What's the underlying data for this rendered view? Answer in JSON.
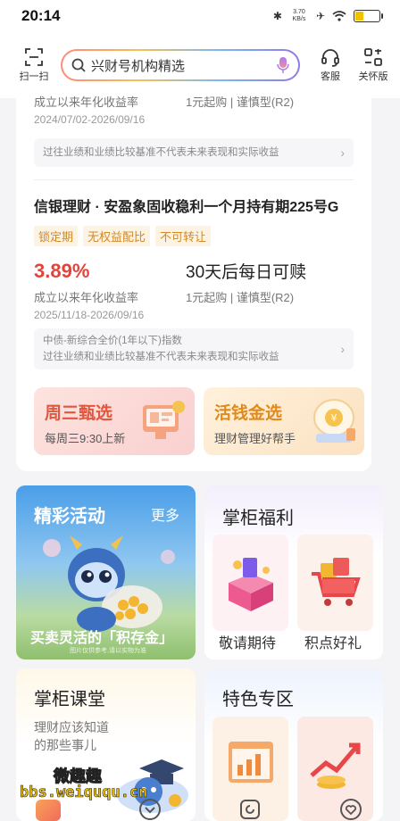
{
  "status": {
    "time": "20:14",
    "net_speed": "3.70 KB/s"
  },
  "header": {
    "scan_label": "扫一扫",
    "search_placeholder": "兴财号机构精选",
    "service_label": "客服",
    "care_label": "关怀版"
  },
  "product_prev": {
    "rate_label": "成立以来年化收益率",
    "purchase_info": "1元起购 | 谨慎型(R2)",
    "date_range": "2024/07/02-2026/09/16",
    "notice": "过往业绩和业绩比较基准不代表未来表现和实际收益"
  },
  "product": {
    "title": "信银理财 · 安盈象固收稳利一个月持有期225号G",
    "tags": [
      "锁定期",
      "无权益配比",
      "不可转让"
    ],
    "rate": "3.89%",
    "redeem": "30天后每日可赎",
    "rate_label": "成立以来年化收益率",
    "purchase_info": "1元起购 | 谨慎型(R2)",
    "date_range": "2025/11/18-2026/09/16",
    "benchmark": "中债-新综合全价(1年以下)指数",
    "notice": "过往业绩和业绩比较基准不代表未来表现和实际收益"
  },
  "promos": [
    {
      "title": "周三甄选",
      "subtitle": "每周三9:30上新"
    },
    {
      "title": "活钱金选",
      "subtitle": "理财管理好帮手"
    }
  ],
  "activity": {
    "title": "精彩活动",
    "more": "更多",
    "caption": "买卖灵活的「积存金」",
    "disclaimer": "图片仅供参考,请以实物为准"
  },
  "welfare": {
    "title": "掌柜福利",
    "items": [
      "敬请期待",
      "积点好礼"
    ]
  },
  "classroom": {
    "title": "掌柜课堂",
    "subtitle": "理财应该知道\n的那些事儿"
  },
  "special": {
    "title": "特色专区"
  },
  "watermark": {
    "name": "微趣趣",
    "url": "bbs.weiququ.cn"
  },
  "colors": {
    "accent_red": "#e2443a",
    "tag_orange": "#d08a2b"
  }
}
